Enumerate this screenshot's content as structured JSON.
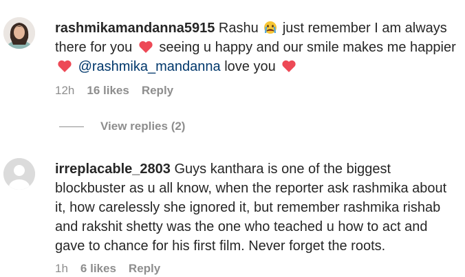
{
  "comments": [
    {
      "username": "rashmikamandanna5915",
      "text_part1": "Rashu",
      "text_part2": "just remember I am always there for you",
      "text_part3": "seeing u happy and our smile makes me happier",
      "mention": "@rashmika_mandanna",
      "text_part4": "love you",
      "time": "12h",
      "likes": "16 likes",
      "reply": "Reply",
      "view_replies": "View replies (2)"
    },
    {
      "username": "irreplacable_2803",
      "text": "Guys kanthara is one of the biggest blockbuster as u all know, when the reporter ask rashmika about it, how carelessly she ignored it, but remember rashmika rishab and rakshit shetty was the one who teached u how to act and gave to chance for his first film. Never forget the roots.",
      "time": "1h",
      "likes": "6 likes",
      "reply": "Reply"
    }
  ],
  "colors": {
    "text": "#262626",
    "meta": "#8e8e8e",
    "mention": "#00376b",
    "heart": "#ed4956"
  },
  "icons": [
    "heart-icon",
    "crying-emoji-icon",
    "default-avatar-icon"
  ]
}
